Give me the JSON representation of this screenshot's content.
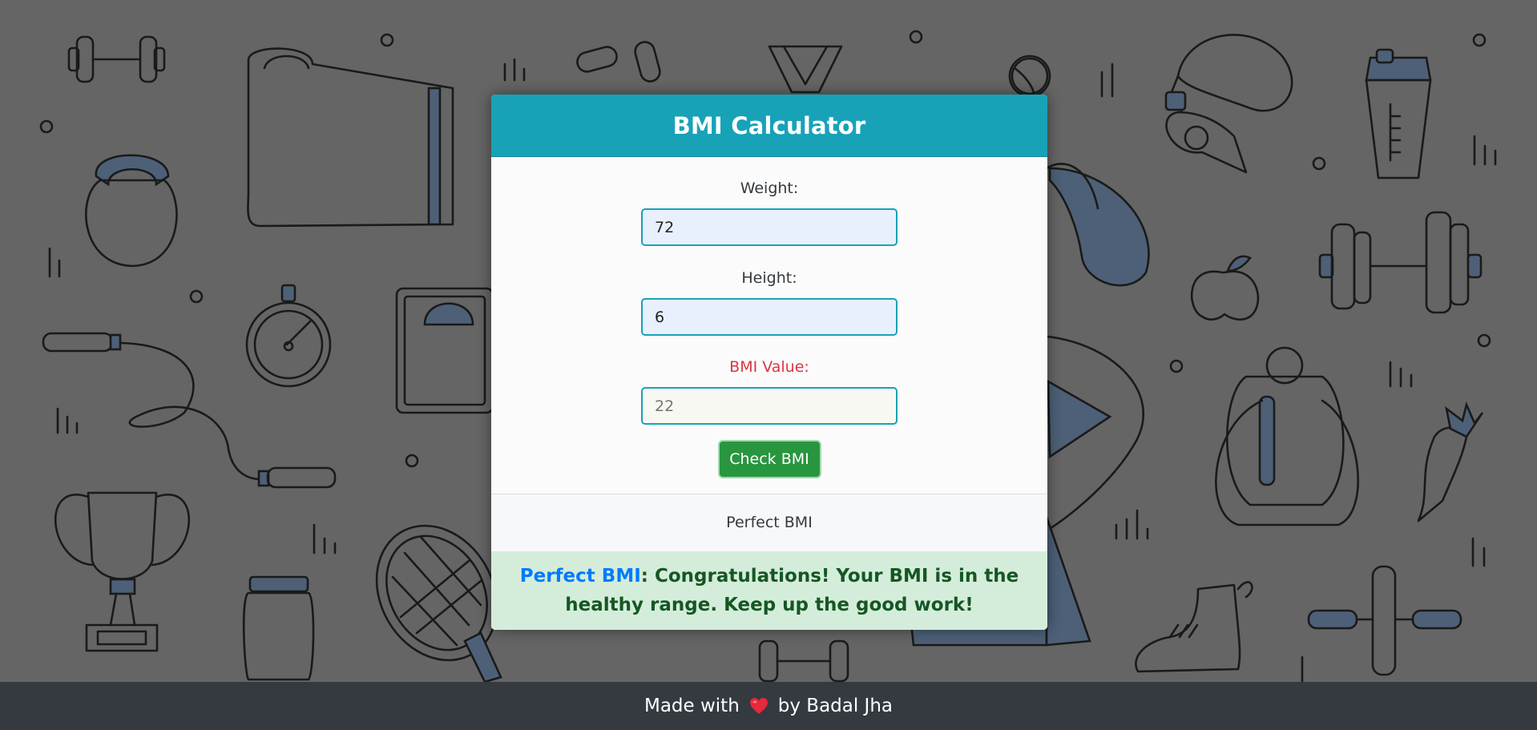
{
  "card": {
    "title": "BMI Calculator",
    "weight": {
      "label": "Weight:",
      "value": "72"
    },
    "height": {
      "label": "Height:",
      "value": "6"
    },
    "bmi": {
      "label": "BMI Value:",
      "placeholder": "22"
    },
    "check_button": "Check BMI",
    "status": "Perfect BMI",
    "alert": {
      "strong": "Perfect BMI",
      "message": ": Congratulations! Your BMI is in the healthy range. Keep up the good work!"
    }
  },
  "footer": {
    "prefix": "Made with",
    "suffix": "by Badal Jha",
    "icon": "heart-icon"
  },
  "colors": {
    "header": "#17a2b8",
    "button": "#28963f",
    "alert_bg": "#d4edda",
    "alert_text": "#155724",
    "alert_strong": "#007bff",
    "bmi_label": "#dc3545",
    "footer_bg": "#343a40",
    "page_bg": "#656565"
  }
}
